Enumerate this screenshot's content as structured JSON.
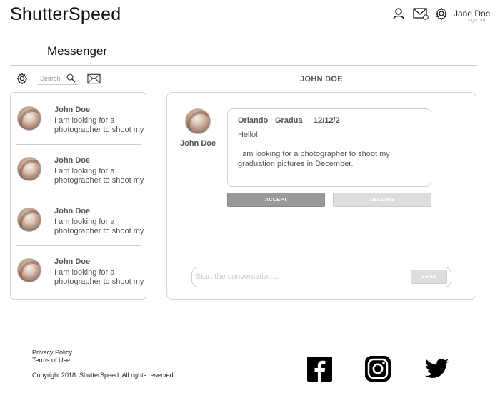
{
  "header": {
    "brand": "ShutterSpeed",
    "user_name": "Jane Doe",
    "sign_out": "sign out",
    "icons": [
      "user-icon",
      "mail-icon",
      "gear-icon"
    ]
  },
  "page": {
    "title": "Messenger"
  },
  "toolbar": {
    "search_placeholder": "Search",
    "icons": [
      "gear-icon",
      "search-icon",
      "mail-icon"
    ]
  },
  "conversations": [
    {
      "name": "John Doe",
      "preview": "I am looking for a photographer to shoot my"
    },
    {
      "name": "John Doe",
      "preview": "I am looking for a photographer to shoot my"
    },
    {
      "name": "John Doe",
      "preview": "I am looking for a photographer to shoot my"
    },
    {
      "name": "John Doe",
      "preview": "I am looking for a photographer to shoot my"
    }
  ],
  "active_conversation": {
    "title": "JOHN DOE",
    "sender_name": "John Doe",
    "request": {
      "location": "Orlando",
      "type": "Gradua",
      "date": "12/12/2",
      "greeting": "Hello!",
      "body": "I am looking for a photographer to shoot my graduation pictures in December."
    },
    "accept_label": "ACCEPT",
    "decline_label": "DECLINE",
    "compose_placeholder": "Start the conversation...",
    "send_label": "SEND"
  },
  "footer": {
    "privacy": "Privacy Policy",
    "terms": "Terms of Use",
    "copyright": "Copyright 2018. ShutterSpeed. All rights reserved.",
    "social": [
      "facebook-icon",
      "instagram-icon",
      "twitter-icon"
    ]
  },
  "colors": {
    "accept_button": "#999999",
    "decline_button": "#dddddd",
    "border": "#d5d5d5",
    "text": "#555555"
  }
}
